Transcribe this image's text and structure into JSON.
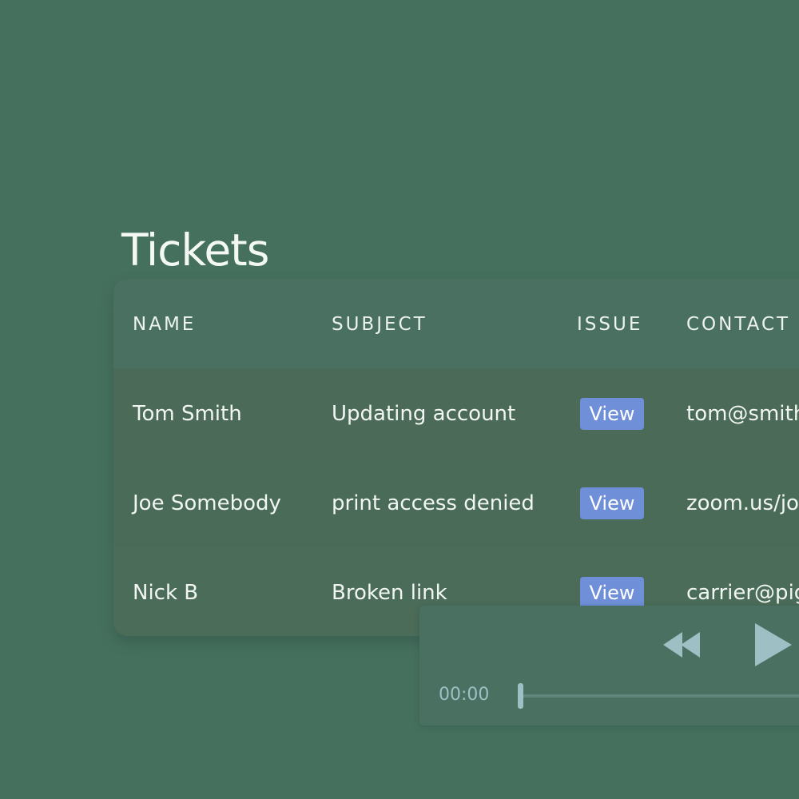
{
  "page": {
    "title": "Tickets"
  },
  "table": {
    "headers": [
      "NAME",
      "SUBJECT",
      "ISSUE",
      "CONTACT"
    ],
    "rows": [
      {
        "name": "Tom Smith",
        "subject": "Updating account",
        "issue_label": "View",
        "contact": "tom@smith"
      },
      {
        "name": "Joe Somebody",
        "subject": "print access denied",
        "issue_label": "View",
        "contact": "zoom.us/jo"
      },
      {
        "name": "Nick B",
        "subject": "Broken link",
        "issue_label": "View",
        "contact": "carrier@pig"
      }
    ]
  },
  "media_player": {
    "time": "00:00",
    "progress": 0,
    "rewind_icon": "rewind-icon",
    "play_icon": "play-icon"
  },
  "colors": {
    "background": "#46705e",
    "view_button": "#6f8fd8",
    "player_controls": "#9ebfc4"
  }
}
